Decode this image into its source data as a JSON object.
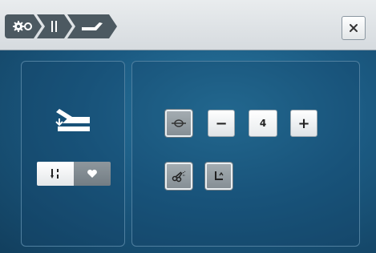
{
  "header": {
    "breadcrumb": [
      {
        "icon": "settings-gear-icon"
      },
      {
        "icon": "needle-icon"
      },
      {
        "icon": "presser-foot-icon"
      }
    ],
    "close_icon": "close-icon"
  },
  "left_panel": {
    "icon": "foot-control-pedal-icon",
    "toggle": [
      {
        "icon": "needle-position-icon",
        "selected": true
      },
      {
        "icon": "heart-icon",
        "selected": false
      }
    ]
  },
  "right_panel": {
    "function_button_icon": "thread-tension-icon",
    "decrement_label": "−",
    "value": "4",
    "increment_label": "+",
    "thread_cut_icon": "thread-cutter-icon",
    "presser_foot_up_icon": "presser-foot-up-icon"
  },
  "colors": {
    "background": "#1b5a82",
    "topbar": "#dde1e4",
    "crumb": "#4c5961",
    "panel_border": "#4f7f9f"
  }
}
